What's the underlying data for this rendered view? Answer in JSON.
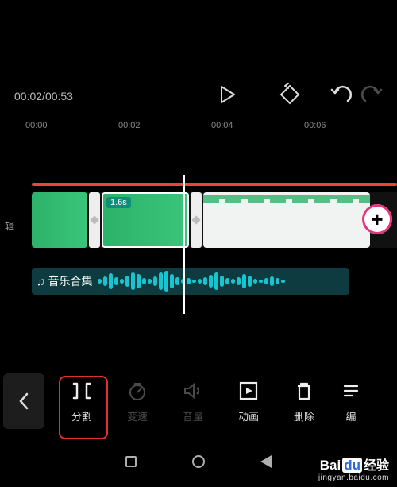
{
  "player": {
    "current": "00:02",
    "total": "00:53"
  },
  "ruler": [
    "00:00",
    "00:02",
    "00:04",
    "00:06"
  ],
  "clip_badge": "1.6s",
  "left_tag": "辑",
  "audio": {
    "note_glyph": "♫",
    "label": "音乐合集"
  },
  "tools": {
    "split": "分割",
    "speed": "变速",
    "volume": "音量",
    "anim": "动画",
    "delete": "删除",
    "edit": "编"
  },
  "watermark": {
    "brand_en": "Bai",
    "brand_du": "du",
    "brand_cn": "经验",
    "url": "jingyan.baidu.com"
  },
  "wave_heights": [
    6,
    12,
    20,
    10,
    6,
    14,
    22,
    18,
    8,
    6,
    12,
    22,
    26,
    18,
    10,
    6,
    8,
    4,
    6,
    10,
    16,
    22,
    14,
    8,
    6,
    10,
    18,
    14,
    6,
    4,
    8,
    12,
    8,
    4
  ]
}
